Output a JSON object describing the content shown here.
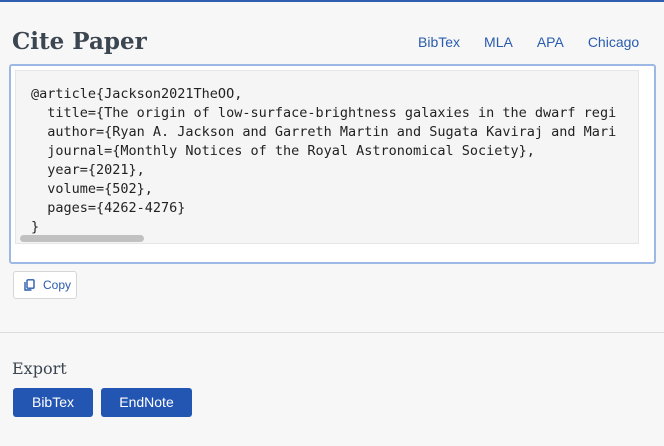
{
  "header": {
    "title": "Cite Paper"
  },
  "tabs": [
    {
      "label": "BibTex",
      "active": true
    },
    {
      "label": "MLA",
      "active": false
    },
    {
      "label": "APA",
      "active": false
    },
    {
      "label": "Chicago",
      "active": false
    }
  ],
  "citation": {
    "bibtex": "@article{Jackson2021TheOO,\n  title={The origin of low-surface-brightness galaxies in the dwarf regi\n  author={Ryan A. Jackson and Garreth Martin and Sugata Kaviraj and Mari\n  journal={Monthly Notices of the Royal Astronomical Society},\n  year={2021},\n  volume={502},\n  pages={4262-4276}\n}"
  },
  "actions": {
    "copy_label": "Copy"
  },
  "export": {
    "title": "Export",
    "bibtex_label": "BibTex",
    "endnote_label": "EndNote"
  },
  "colors": {
    "accent": "#2356b3",
    "tab_text": "#2a5cad",
    "active_indicator": "#3f74c8"
  },
  "icons": {
    "copy": "copy-icon"
  }
}
